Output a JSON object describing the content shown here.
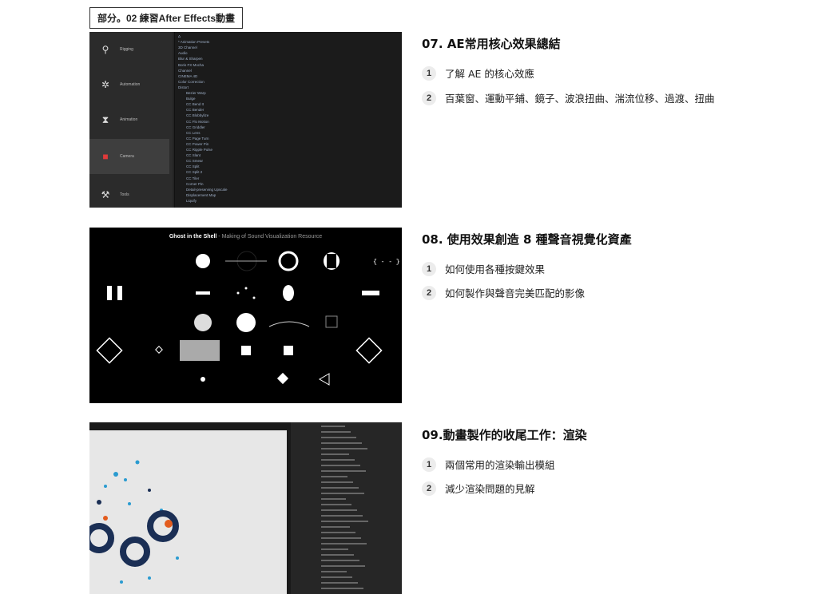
{
  "part_tag": "部分。02 練習After Effects動畫",
  "lessons": [
    {
      "title": "07. AE常用核心效果總結",
      "items": [
        {
          "num": "1",
          "text": "了解 AE 的核心效應"
        },
        {
          "num": "2",
          "text": "百葉窗、運動平鋪、鏡子、波浪扭曲、湍流位移、過渡、扭曲"
        }
      ]
    },
    {
      "title": "08. 使用效果創造 8 種聲音視覺化資產",
      "items": [
        {
          "num": "1",
          "text": "如何使用各種按鍵效果"
        },
        {
          "num": "2",
          "text": "如何製作與聲音完美匹配的影像"
        }
      ]
    },
    {
      "title": "09.動畫製作的收尾工作：渲染",
      "items": [
        {
          "num": "1",
          "text": "兩個常用的渲染輸出模組"
        },
        {
          "num": "2",
          "text": "減少渲染問題的見解"
        }
      ]
    }
  ],
  "thumb1": {
    "sidebar": [
      {
        "label": "Rigging",
        "icon": "rigging-icon"
      },
      {
        "label": "Automation",
        "icon": "gear-icon"
      },
      {
        "label": "Animation",
        "icon": "hourglass-icon"
      },
      {
        "label": "Camera",
        "icon": "camera-icon"
      },
      {
        "label": "Tools",
        "icon": "tools-icon"
      }
    ],
    "rows": [
      "Δ",
      "* Animation Presets",
      "3D Channel",
      "Audio",
      "Blur & Sharpen",
      "Boris FX Mocha",
      "Channel",
      "CINEMA 4D",
      "Color Correction",
      "Distort",
      "Bezier Warp",
      "Bulge",
      "CC Bend It",
      "CC Bender",
      "CC Blobbylize",
      "CC Flo Motion",
      "CC Griddler",
      "CC Lens",
      "CC Page Turn",
      "CC Power Pin",
      "CC Ripple Pulse",
      "CC Slant",
      "CC Smear",
      "CC Split",
      "CC Split 2",
      "CC Tiler",
      "Corner Pin",
      "Detail-preserving Upscale",
      "Displacement Map",
      "Liquify"
    ]
  },
  "thumb2": {
    "title_bold": "Ghost in the Shell",
    "title_rest": " - Making of Sound Visualization Resource"
  }
}
